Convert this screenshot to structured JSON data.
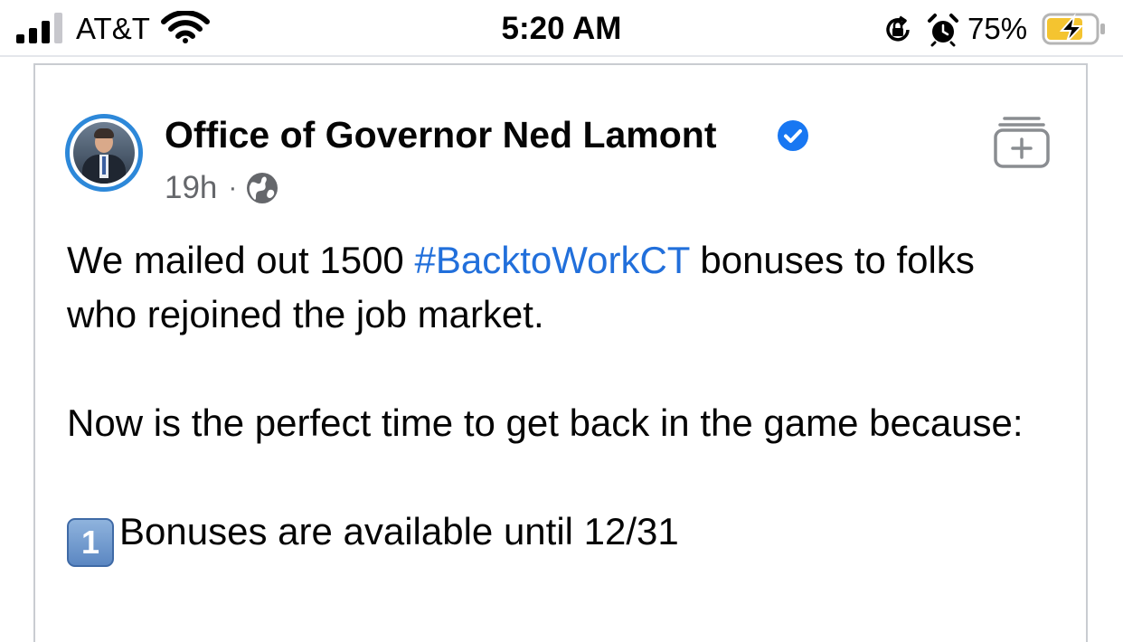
{
  "status_bar": {
    "carrier": "AT&T",
    "time": "5:20 AM",
    "battery_percent": "75%",
    "battery_level": 0.75,
    "icons": [
      "signal-icon",
      "wifi-icon",
      "rotation-lock-icon",
      "alarm-icon",
      "battery-charging-icon"
    ]
  },
  "post": {
    "page_name": "Office of Governor Ned Lamont",
    "verified": true,
    "timestamp": "19h",
    "separator": "·",
    "audience_icon": "globe-icon",
    "save_icon": "add-to-collection-icon",
    "text": {
      "p1_before": "We mailed out 1500 ",
      "p1_hashtag": "#BacktoWorkCT",
      "p1_after": " bonuses to folks who rejoined the job market.",
      "p2": "Now is the perfect time to get back in the game because:",
      "item1_emoji_number": "1",
      "item1_text": "Bonuses are available until 12/31"
    }
  },
  "colors": {
    "hashtag": "#216fdb",
    "verified_badge": "#1877f2",
    "avatar_ring": "#2d88d9",
    "secondary_text": "#65676b",
    "card_border": "#c9ccd1",
    "battery_fill": "#f4c430"
  }
}
